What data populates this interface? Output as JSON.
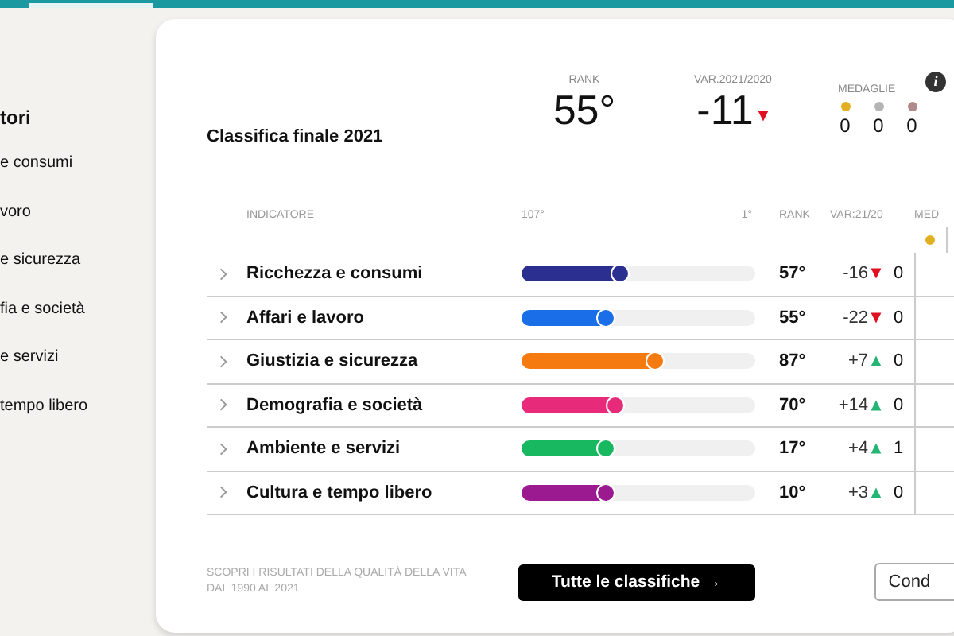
{
  "sidebar": {
    "title": "tori",
    "items": [
      "e consumi",
      "voro",
      "e sicurezza",
      "fia e società",
      "e servizi",
      "tempo libero"
    ]
  },
  "card": {
    "title": "Classifica finale 2021",
    "rank": {
      "label": "RANK",
      "value": "55°"
    },
    "variation": {
      "label": "VAR.2021/2020",
      "value": "-11",
      "up": false
    },
    "medals": {
      "label": "MEDAGLIE",
      "info": "i",
      "items": [
        {
          "color": "#e0b020",
          "count": "0"
        },
        {
          "color": "#b4b4b4",
          "count": "0"
        },
        {
          "color": "#b08a8a",
          "count": "0"
        }
      ]
    },
    "table": {
      "columns": [
        "INDICATORE",
        "107°",
        "1°",
        "RANK",
        "VAR:21/20",
        "MED"
      ],
      "rows": [
        {
          "name": "Ricchezza e consumi",
          "color": "#2b2f8f",
          "level": 0.45,
          "rank": "57°",
          "variation": "-16",
          "up": false,
          "medals": "0"
        },
        {
          "name": "Affari e lavoro",
          "color": "#1a6ee8",
          "level": 0.39,
          "rank": "55°",
          "variation": "-22",
          "up": false,
          "medals": "0"
        },
        {
          "name": "Giustizia e sicurezza",
          "color": "#f57a0f",
          "level": 0.6,
          "rank": "87°",
          "variation": "+7",
          "up": true,
          "medals": "0"
        },
        {
          "name": "Demografia e società",
          "color": "#e82a7a",
          "level": 0.43,
          "rank": "70°",
          "variation": "+14",
          "up": true,
          "medals": "0"
        },
        {
          "name": "Ambiente e servizi",
          "color": "#18b860",
          "level": 0.39,
          "rank": "17°",
          "variation": "+4",
          "up": true,
          "medals": "1"
        },
        {
          "name": "Cultura e tempo libero",
          "color": "#9b1a8f",
          "level": 0.39,
          "rank": "10°",
          "variation": "+3",
          "up": true,
          "medals": "0"
        }
      ]
    },
    "footer": {
      "note": "SCOPRI I RISULTATI DELLA QUALITÀ DELLA VITA DAL 1990 AL 2021",
      "button": "Tutte le classifiche",
      "button_arrow": "→",
      "secondary_button": "Cond"
    }
  }
}
